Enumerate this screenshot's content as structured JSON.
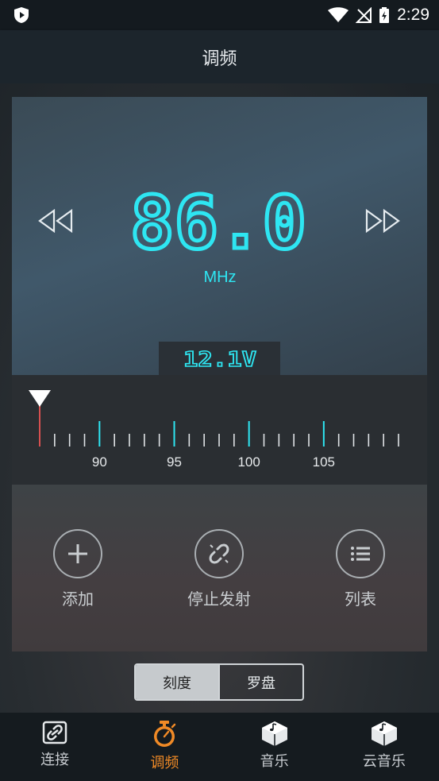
{
  "status_bar": {
    "time": "2:29"
  },
  "header": {
    "title": "调频"
  },
  "display": {
    "frequency": "86.0",
    "unit": "MHz",
    "voltage": "12.1V",
    "prev_icon": "rewind-icon",
    "next_icon": "fast-forward-icon"
  },
  "scale": {
    "labels": [
      "90",
      "95",
      "100",
      "105"
    ],
    "min": 86.0,
    "max": 110.0,
    "current": 86.0
  },
  "controls": {
    "add_label": "添加",
    "stop_label": "停止发射",
    "list_label": "列表"
  },
  "view_toggle": {
    "scale_label": "刻度",
    "dial_label": "罗盘",
    "selected": "刻度"
  },
  "nav": {
    "items": [
      {
        "label": "连接",
        "icon": "link-icon",
        "active": false
      },
      {
        "label": "调频",
        "icon": "stopwatch-icon",
        "active": true
      },
      {
        "label": "音乐",
        "icon": "music-box-icon",
        "active": false
      },
      {
        "label": "云音乐",
        "icon": "cloud-music-box-icon",
        "active": false
      }
    ]
  },
  "colors": {
    "accent": "#2ee6f2",
    "active_nav": "#f08a26",
    "pointer": "#d65050"
  }
}
